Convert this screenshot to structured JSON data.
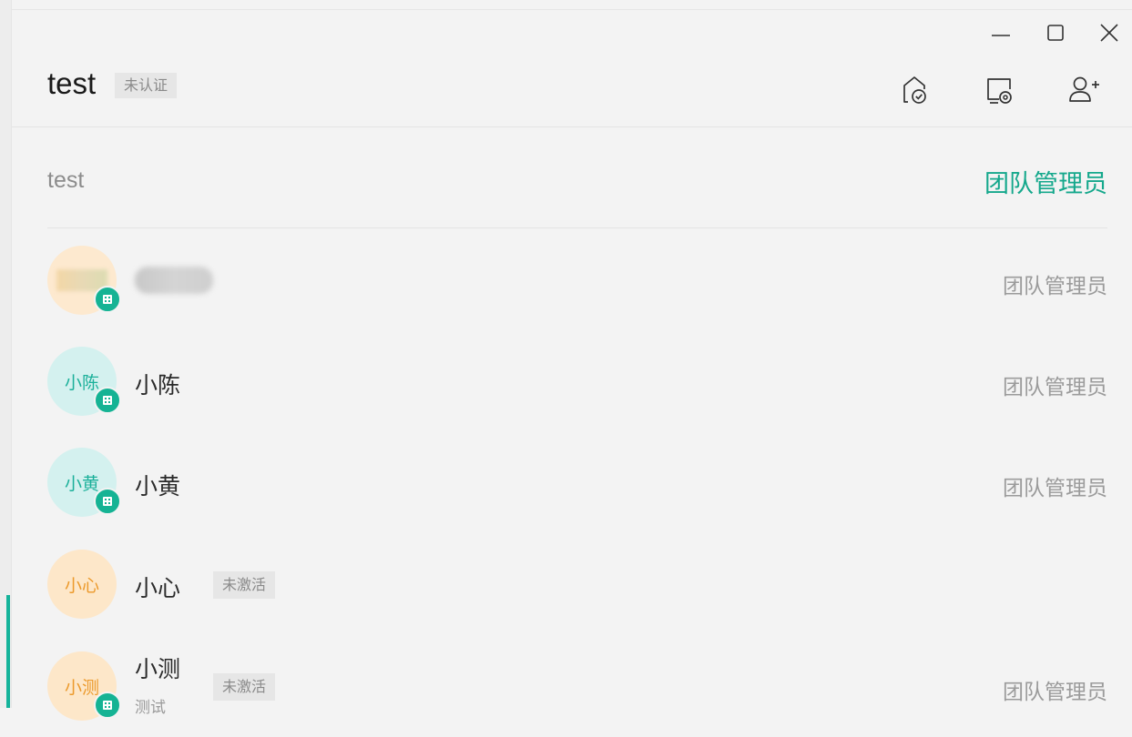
{
  "window": {
    "minimize_icon": "minimize-icon",
    "maximize_icon": "maximize-icon",
    "close_icon": "close-icon"
  },
  "header": {
    "title": "test",
    "status_badge": "未认证",
    "icons": [
      "team-verify-icon",
      "screen-settings-icon",
      "add-member-icon"
    ]
  },
  "team": {
    "name": "test",
    "role": "团队管理员"
  },
  "members": [
    {
      "avatar": "",
      "name": "",
      "role": "团队管理员",
      "org_icon": "organization-icon"
    },
    {
      "avatar": "小陈",
      "name": "小陈",
      "role": "团队管理员",
      "org_icon": "organization-icon"
    },
    {
      "avatar": "小黄",
      "name": "小黄",
      "role": "团队管理员",
      "org_icon": "organization-icon"
    },
    {
      "avatar": "小心",
      "name": "小心",
      "status": "未激活",
      "role": ""
    },
    {
      "avatar": "小测",
      "name": "小测",
      "sub": "测试",
      "status": "未激活",
      "role": "团队管理员",
      "org_icon": "organization-icon"
    }
  ],
  "colors": {
    "accent": "#15a88c",
    "avatar_teal_bg": "#d4f1ef",
    "avatar_orange_bg": "#fde7c9"
  }
}
